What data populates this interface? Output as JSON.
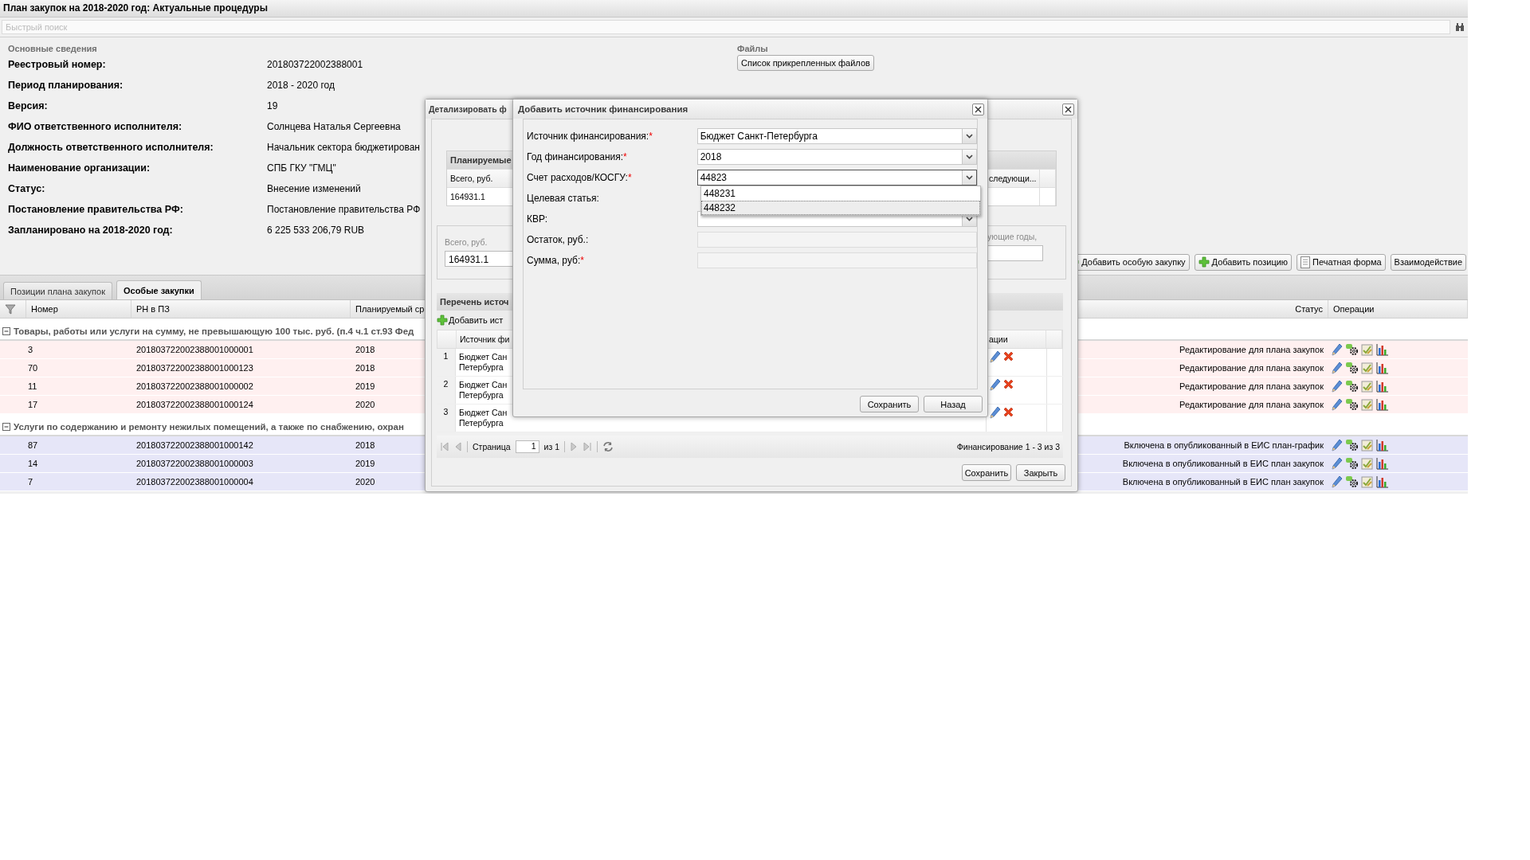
{
  "window": {
    "title": "План закупок на 2018-2020 год: Актуальные процедуры"
  },
  "search": {
    "placeholder": "Быстрый поиск"
  },
  "info": {
    "title": "Основные сведения",
    "rows": [
      {
        "label": "Реестровый номер:",
        "value": "201803722002388001"
      },
      {
        "label": "Период планирования:",
        "value": "2018 - 2020 год"
      },
      {
        "label": "Версия:",
        "value": "19"
      },
      {
        "label": "ФИО ответственного исполнителя:",
        "value": "Солнцева Наталья Сергеевна"
      },
      {
        "label": "Должность ответственного исполнителя:",
        "value": "Начальник сектора бюджетирован"
      },
      {
        "label": "Наименование организации:",
        "value": "СПБ ГКУ \"ГМЦ\""
      },
      {
        "label": "Статус:",
        "value": "Внесение изменений"
      },
      {
        "label": "Постановление правительства РФ:",
        "value": "Постановление правительства РФ"
      },
      {
        "label": "Запланировано на 2018-2020 год:",
        "value": "6 225 533 206,79 RUB"
      }
    ]
  },
  "files": {
    "title": "Файлы",
    "button": "Список прикрепленных файлов"
  },
  "toolbar": [
    {
      "label": "Добавить особую закупку",
      "kind": "add"
    },
    {
      "label": "Добавить позицию",
      "kind": "add"
    },
    {
      "label": "Печатная форма",
      "kind": "print"
    },
    {
      "label": "Взаимодействие",
      "kind": "plain"
    }
  ],
  "tabs": [
    {
      "label": "Позиции плана закупок",
      "selected": false
    },
    {
      "label": "Особые закупки",
      "selected": true
    }
  ],
  "table": {
    "columns": [
      "Номер",
      "РН в ПЗ",
      "Планируемый ср",
      "Статус",
      "Операции"
    ],
    "groups": [
      {
        "title": "Товары, работы или услуги на сумму, не превышающую 100 тыс. руб. (п.4 ч.1 ст.93 Фед",
        "expanded": true,
        "color": "#fff0f0",
        "rows": [
          {
            "number": "3",
            "rn": "201803722002388001000001",
            "planned": "2018",
            "status": "Редактирование для плана закупок"
          },
          {
            "number": "70",
            "rn": "201803722002388001000123",
            "planned": "2018",
            "status": "Редактирование для плана закупок"
          },
          {
            "number": "11",
            "rn": "201803722002388001000002",
            "planned": "2019",
            "status": "Редактирование для плана закупок"
          },
          {
            "number": "17",
            "rn": "201803722002388001000124",
            "planned": "2020",
            "status": "Редактирование для плана закупок"
          }
        ]
      },
      {
        "title": "Услуги по содержанию и ремонту нежилых помещений, а также по снабжению, охран",
        "expanded": true,
        "color": "#e6e6f8",
        "rows": [
          {
            "number": "87",
            "rn": "201803722002388001000142",
            "planned": "2018",
            "status": "Включена в опубликованный в ЕИС план-график"
          },
          {
            "number": "14",
            "rn": "201803722002388001000003",
            "planned": "2019",
            "status": "Включена в опубликованный в ЕИС план закупок"
          },
          {
            "number": "7",
            "rn": "201803722002388001000004",
            "planned": "2020",
            "status": "Включена в опубликованный в ЕИС план закупок"
          }
        ]
      }
    ]
  },
  "detail_dialog": {
    "title": "Детализировать ф",
    "planned": {
      "title": "Планируемые",
      "columns": [
        "Всего, руб.",
        "следующи..."
      ],
      "values": [
        "164931.1"
      ]
    },
    "totals": {
      "label": "Всего, руб.",
      "value": "164931.1",
      "next_label": "ующие годы,"
    },
    "sources": {
      "title": "Перечень источ",
      "add_button": "Добавить ист",
      "columns": [
        "Источник фи",
        "ации"
      ],
      "rows": [
        {
          "index": "1",
          "source_lines": [
            "Бюджет Сан",
            "Петербурга"
          ]
        },
        {
          "index": "2",
          "source_lines": [
            "Бюджет Сан",
            "Петербурга"
          ]
        },
        {
          "index": "3",
          "source_lines": [
            "Бюджет Сан",
            "Петербурга"
          ]
        }
      ]
    },
    "pager": {
      "page_label": "Страница",
      "page": "1",
      "of": "из 1",
      "summary": "Финансирование 1 - 3 из 3"
    },
    "buttons": [
      "Сохранить",
      "Закрыть"
    ]
  },
  "source_dialog": {
    "title": "Добавить источник финансирования",
    "fields": [
      {
        "label": "Источник финансирования:",
        "mark": "*",
        "kind": "combo",
        "value": "Бюджет Санкт-Петербурга",
        "expanded": false
      },
      {
        "label": "Год финансирования:",
        "mark": "*",
        "kind": "combo",
        "value": "2018",
        "expanded": false
      },
      {
        "label": "Счет расходов/КОСГУ:",
        "mark": "*",
        "kind": "combo",
        "value": "44823",
        "expanded": true,
        "options": [
          {
            "label": "448231",
            "selected": false
          },
          {
            "label": "448232",
            "selected": true
          }
        ]
      },
      {
        "label": "Целевая статья:"
      },
      {
        "label": "КВР:",
        "kind": "combo",
        "expanded": false
      },
      {
        "label": "Остаток, руб.:",
        "kind": "text"
      },
      {
        "label": "Сумма, руб:",
        "mark": "*",
        "kind": "text"
      }
    ],
    "buttons": [
      "Сохранить",
      "Назад"
    ]
  }
}
